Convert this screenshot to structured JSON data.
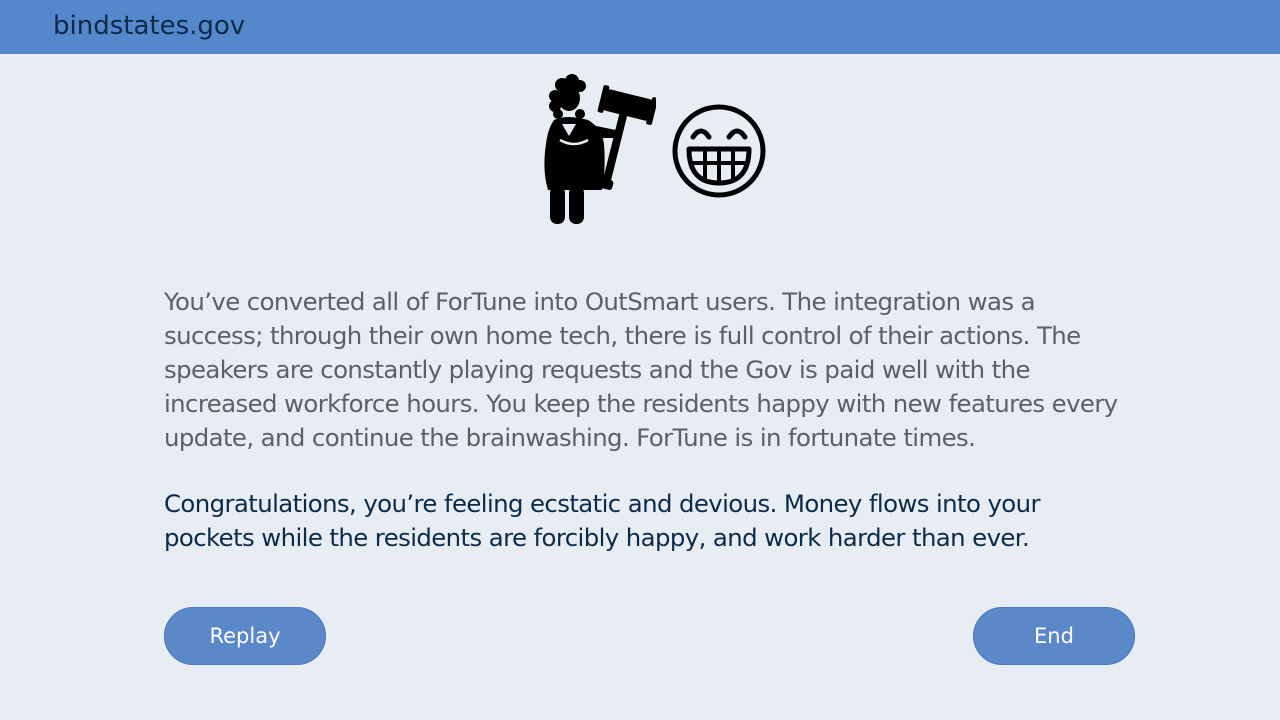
{
  "header": {
    "site_title": "bindstates.gov"
  },
  "icons": {
    "left": "judge-with-gavel-icon",
    "right": "grinning-face-icon"
  },
  "ending": {
    "story": "You’ve converted all of ForTune into OutSmart users. The integration was a success; through their own home tech, there is full control of their actions. The speakers are constantly playing requests and the Gov is paid well with the increased workforce hours. You keep the residents happy with new features every update, and continue the brainwashing. ForTune is in fortunate times.",
    "outcome": "Congratulations, you’re feeling ecstatic and devious. Money flows into your pockets while the residents are forcibly happy, and work harder than ever."
  },
  "buttons": {
    "replay_label": "Replay",
    "end_label": "End"
  },
  "colors": {
    "header_bar": "#5588cb",
    "background": "#e7edf2",
    "button": "#5a88c9",
    "dark_text": "#0c2a4a",
    "muted_text": "#5a5f6b"
  }
}
